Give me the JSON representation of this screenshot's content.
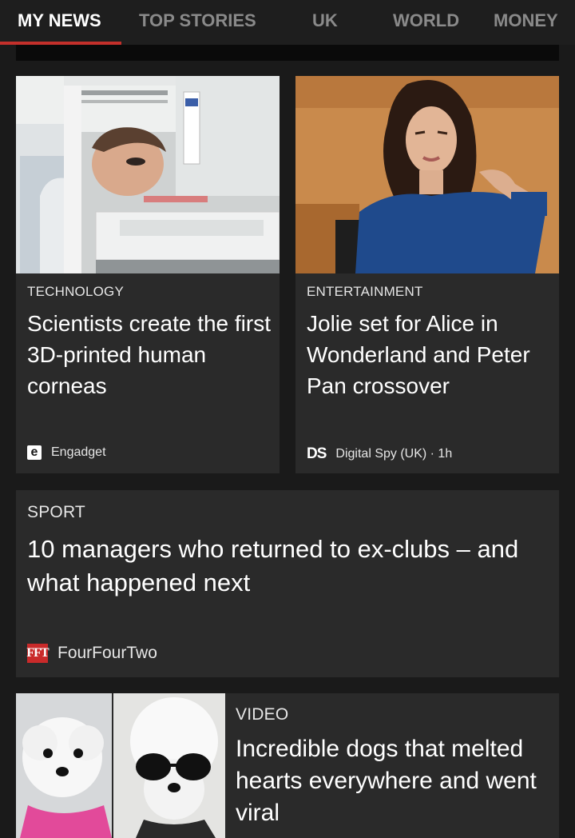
{
  "tabs": [
    {
      "label": "MY NEWS",
      "active": true
    },
    {
      "label": "TOP STORIES",
      "active": false
    },
    {
      "label": "UK",
      "active": false
    },
    {
      "label": "WORLD",
      "active": false
    },
    {
      "label": "MONEY",
      "active": false
    }
  ],
  "colors": {
    "background": "#1a1a1a",
    "card": "#2a2a2a",
    "accent": "#c4302b",
    "inactive_tab": "#8a8a8a"
  },
  "cards": [
    {
      "category": "TECHNOLOGY",
      "headline": "Scientists create the first 3D-printed human corneas",
      "source": "Engadget",
      "source_logo": "engadget-logo",
      "logo_text": "e",
      "image": "lab-scientist-photo"
    },
    {
      "category": "ENTERTAINMENT",
      "headline": "Jolie set for Alice in Wonderland and Peter Pan crossover",
      "source": "Digital Spy (UK) · 1h",
      "source_logo": "digital-spy-logo",
      "logo_text": "DS",
      "image": "actress-portrait-photo"
    },
    {
      "category": "SPORT",
      "headline": "10 managers who returned to ex-clubs – and what happened next",
      "source": "FourFourTwo",
      "source_logo": "fourfourtwo-logo",
      "logo_text": "FFT"
    },
    {
      "category": "VIDEO",
      "headline": "Incredible dogs that melted hearts everywhere and went viral",
      "image": "white-dogs-photo"
    }
  ]
}
